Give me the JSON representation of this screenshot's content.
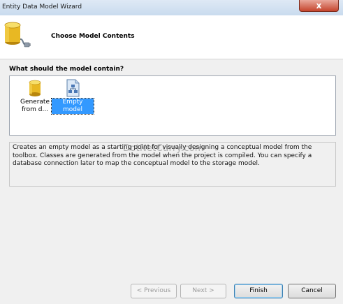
{
  "window": {
    "title": "Entity Data Model Wizard",
    "close_label": "x"
  },
  "header": {
    "title": "Choose Model Contents",
    "icon": "database-connection-icon"
  },
  "question": "What should the model contain?",
  "options": [
    {
      "label": "Generate from d...",
      "icon": "database-icon",
      "selected": false
    },
    {
      "label": "Empty model",
      "icon": "empty-model-icon",
      "selected": true
    }
  ],
  "description": "Creates an empty model as a starting point for visually designing a conceptual model from the toolbox. Classes are generated from the model when the project is compiled. You can specify a database connection later to map the conceptual model to the storage model.",
  "watermark": "DotNetCurry.com",
  "buttons": {
    "previous": "< Previous",
    "next": "Next >",
    "finish": "Finish",
    "cancel": "Cancel"
  },
  "colors": {
    "selection": "#3399ff",
    "close": "#c5452d"
  }
}
